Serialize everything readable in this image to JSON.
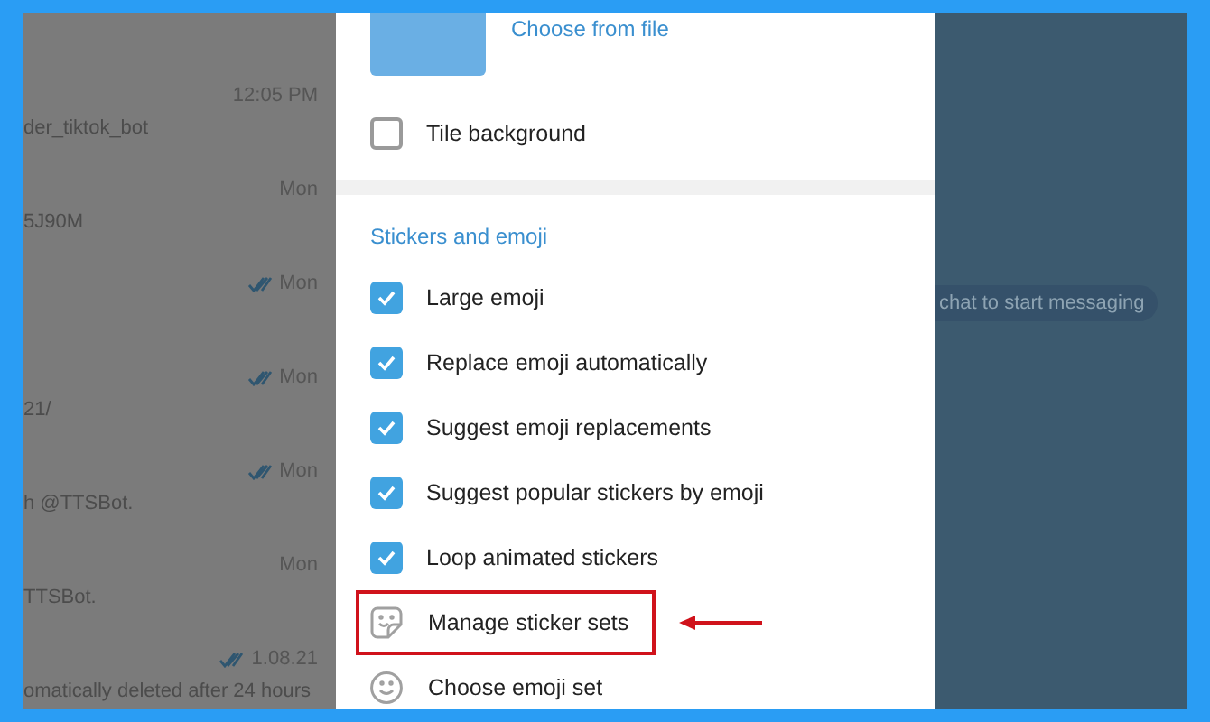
{
  "chat_list": [
    {
      "time": "12:05 PM",
      "read": false,
      "preview": "der_tiktok_bot"
    },
    {
      "time": "Mon",
      "read": false,
      "preview": "5J90M"
    },
    {
      "time": "Mon",
      "read": true
    },
    {
      "time": "Mon",
      "read": true,
      "preview": "21/"
    },
    {
      "time": "Mon",
      "read": true,
      "preview": "h @TTSBot."
    },
    {
      "time": "Mon",
      "read": false,
      "preview": "TTSBot."
    },
    {
      "time": "1.08.21",
      "read": true,
      "preview": "omatically deleted after 24 hours"
    }
  ],
  "settings_dialog": {
    "background_file_link": "Choose from file",
    "tile_background": {
      "label": "Tile background",
      "checked": false
    },
    "section_title": "Stickers and emoji",
    "options": [
      {
        "kind": "checkbox",
        "label": "Large emoji",
        "checked": true
      },
      {
        "kind": "checkbox",
        "label": "Replace emoji automatically",
        "checked": true
      },
      {
        "kind": "checkbox",
        "label": "Suggest emoji replacements",
        "checked": true
      },
      {
        "kind": "checkbox",
        "label": "Suggest popular stickers by emoji",
        "checked": true
      },
      {
        "kind": "checkbox",
        "label": "Loop animated stickers",
        "checked": true
      },
      {
        "kind": "stickers",
        "label": "Manage sticker sets",
        "annotated": true
      },
      {
        "kind": "emoji",
        "label": "Choose emoji set",
        "annotated": false
      }
    ]
  },
  "empty_chat_hint": "chat to start messaging"
}
